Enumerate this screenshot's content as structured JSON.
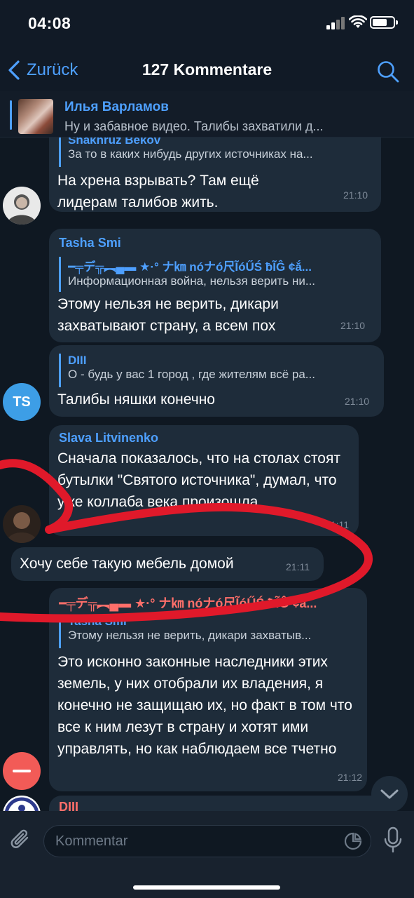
{
  "status": {
    "time": "04:08"
  },
  "nav": {
    "back_label": "Zurück",
    "title": "127 Kommentare"
  },
  "pinned": {
    "name": "Илья Варламов",
    "text": "Ну и забавное видео. Талибы захватили д..."
  },
  "messages": [
    {
      "quote_name": "Shakhruz Bekov",
      "quote_text": "За то в каких нибудь других источниках на...",
      "text": "На хрена взрывать? Там ещё лидерам талибов жить.",
      "time": "21:10"
    },
    {
      "sender": "Tasha Smi",
      "quote_name": "━╤デ╦︻▄▬ ★·° ナ㎞ nóナó尺ĨóŰŚ ƀĨĜ ¢ắ...",
      "quote_text": "Информационная война, нельзя верить ни...",
      "text": "Этому нельзя не верить, дикари захватывают страну, а всем пох",
      "time": "21:10"
    },
    {
      "quote_name": "DIII",
      "quote_text": "О - будь у вас 1 город , где жителям всё ра...",
      "text": "Талибы няшки конечно",
      "time": "21:10",
      "avatar_initials": "TS"
    },
    {
      "sender": "Slava Litvinenko",
      "text": "Сначала показалось, что на столах стоят бутылки \"Святого источника\", думал, что уже коллаба века произошла",
      "time": "21:11"
    },
    {
      "text": "Хочу себе такую мебель домой",
      "time": "21:11"
    },
    {
      "sender": "━╤デ╦︻▄▬ ★·° ナ㎞ nóナó尺ĨóŰŚ ƀĨĜ ¢ắ...",
      "quote_name": "Tasha Smi",
      "quote_text": "Этому нельзя не верить, дикари захватыв...",
      "text": "Это исконно законные наследники этих земель, у них отобрали их владения, я конечно не защищаю их, но факт в том что  все к ним лезут в страну и хотят ими управлять, но как наблюдаем все тчетно",
      "time": "21:12"
    },
    {
      "sender": "DIII"
    }
  ],
  "input": {
    "placeholder": "Kommentar"
  },
  "colors": {
    "accent": "#4ea0ff",
    "bubble": "#1e2c3a",
    "annotation": "#e0192a"
  }
}
